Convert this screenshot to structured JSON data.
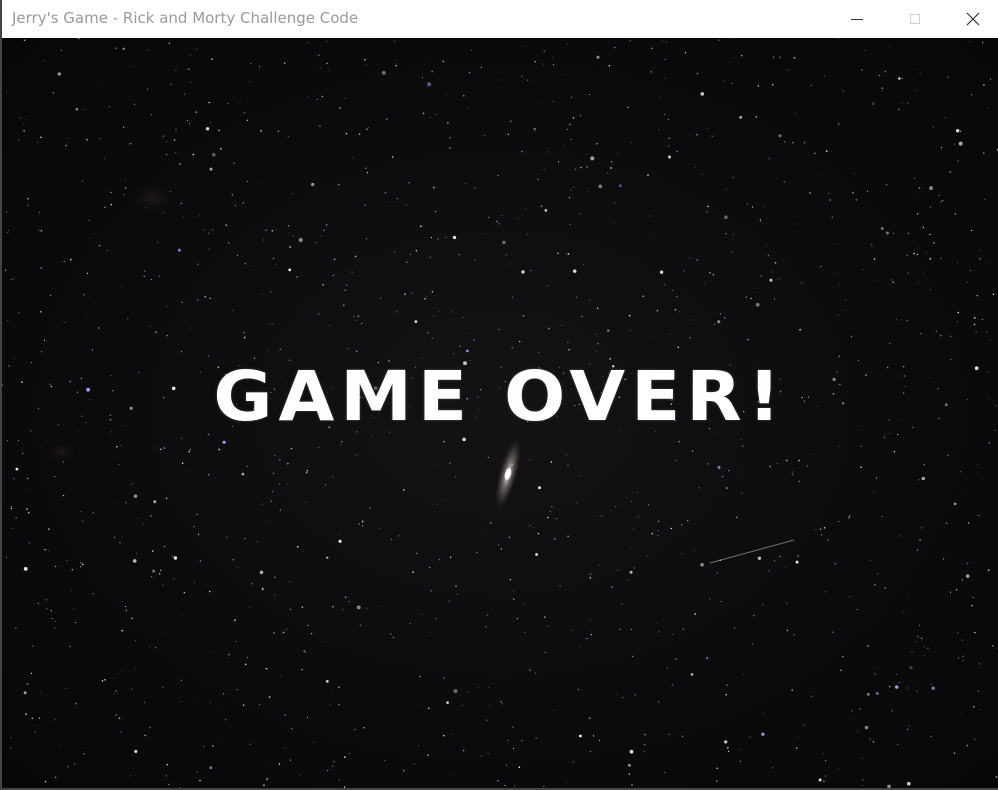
{
  "window": {
    "title": "Jerry's Game - Rick and Morty Challenge Code",
    "controls": {
      "minimize_icon": "minimize-icon",
      "maximize_icon": "maximize-icon",
      "close_icon": "close-icon"
    }
  },
  "game": {
    "message": "GAME OVER!",
    "background": "starfield",
    "colors": {
      "text": "#ffffff",
      "sky": "#0c0a0c",
      "star_white": "#ffffff",
      "star_purple": "#b6a4ff"
    }
  }
}
